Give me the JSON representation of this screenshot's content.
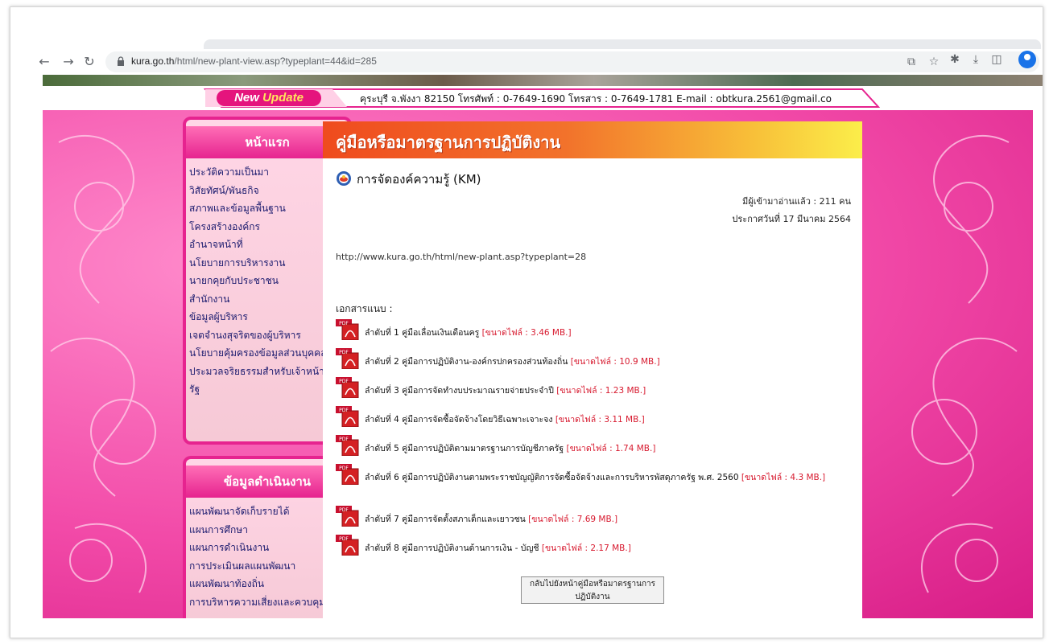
{
  "browser": {
    "url_domain": "kura.go.th",
    "url_path": "/html/new-plant-view.asp?typeplant=44&id=285"
  },
  "newsbar": {
    "badge_new": "New",
    "badge_update": "Update",
    "ticker": "คุระบุรี จ.พังงา 82150 โทรศัพท์ : 0-7649-1690 โทรสาร : 0-7649-1781 E-mail : obtkura.2561@gmail.co"
  },
  "sidebar1": {
    "title": "หน้าแรก",
    "items": [
      "ประวัติความเป็นมา",
      "วิสัยทัศน์/พันธกิจ",
      "สภาพและข้อมูลพื้นฐาน",
      "โครงสร้างองค์กร",
      "อำนาจหน้าที่",
      "นโยบายการบริหารงาน",
      "นายกคุยกับประชาชน",
      "สำนักงาน",
      "ข้อมูลผู้บริหาร",
      "เจตจำนงสุจริตของผู้บริหาร",
      "นโยบายคุ้มครองข้อมูลส่วนบุคคล",
      "ประมวลจริยธรรมสำหรับเจ้าหน้าที่ของ",
      "รัฐ"
    ]
  },
  "sidebar2": {
    "title": "ข้อมูลดำเนินงาน",
    "items": [
      "แผนพัฒนาจัดเก็บรายได้",
      "แผนการศึกษา",
      "แผนการดำเนินงาน",
      "การประเมินผลแผนพัฒนา",
      "แผนพัฒนาท้องถิ่น",
      "การบริหารความเสี่ยงและควบคุม"
    ]
  },
  "main": {
    "header": "คู่มือหรือมาตรฐานการปฏิบัติงาน",
    "title": "การจัดองค์ความรู้ (KM)",
    "readers": "มีผู้เข้ามาอ่านแล้ว : 211 คน",
    "announce": "ประกาศวันที่  17 มีนาคม 2564",
    "link": "http://www.kura.go.th/html/new-plant.asp?typeplant=28",
    "attach_label": "เอกสารแนบ :",
    "pdf_icon_label": "PDF",
    "attachments": [
      {
        "text": "ลำดับที่ 1 คู่มือเลื่อนเงินเดือนครู",
        "size": "[ขนาดไฟล์ : 3.46 MB.]"
      },
      {
        "text": "ลำดับที่ 2 คู่มือการปฏิบัติงาน-องค์กรปกครองส่วนท้องถิ่น",
        "size": "[ขนาดไฟล์ : 10.9 MB.]"
      },
      {
        "text": "ลำดับที่ 3 คู่มือการจัดทำงบประมาณรายจ่ายประจำปี",
        "size": "[ขนาดไฟล์ : 1.23 MB.]"
      },
      {
        "text": "ลำดับที่ 4 คู่มือการจัดซื้อจัดจ้างโดยวิธีเฉพาะเจาะจง",
        "size": "[ขนาดไฟล์ : 3.11 MB.]"
      },
      {
        "text": "ลำดับที่ 5 คู่มือการปฏิบัติตามมาตรฐานการบัญชีภาครัฐ",
        "size": "[ขนาดไฟล์ : 1.74 MB.]"
      },
      {
        "text": "ลำดับที่ 6 คู่มือการปฏิบัติงานตามพระราชบัญญัติการจัดซื้อจัดจ้างและการบริหารพัสดุภาครัฐ พ.ศ. 2560",
        "size": "[ขนาดไฟล์ : 4.3 MB.]"
      },
      {
        "text": "ลำดับที่ 7 คู่มือการจัดตั้งสภาเด็กและเยาวชน",
        "size": "[ขนาดไฟล์ : 7.69 MB.]"
      },
      {
        "text": "ลำดับที่ 8 คู่มือการปฏิบัติงานด้านการเงิน - บัญชี",
        "size": "[ขนาดไฟล์ : 2.17 MB.]"
      }
    ],
    "back_button": "กลับไปยังหน้าคู่มือหรือมาตรฐานการปฏิบัติงาน"
  },
  "colors": {
    "brand_pink": "#e6238f",
    "header_orange": "#ef4b1e",
    "file_size_red": "#d7192e"
  },
  "icons": [
    "back-arrow-icon",
    "forward-arrow-icon",
    "reload-icon",
    "lock-icon",
    "share-icon",
    "star-icon",
    "extensions-icon",
    "download-icon",
    "sidepanel-icon",
    "profile-icon",
    "km-icon",
    "pdf-icon"
  ]
}
